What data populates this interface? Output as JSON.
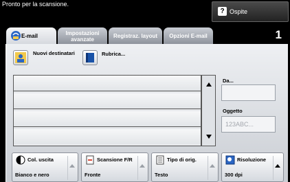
{
  "status_bar": {
    "message": "Pronto per la scansione.",
    "user_label": "Ospite"
  },
  "tabs": [
    {
      "label": "E-mail",
      "active": true
    },
    {
      "label": "Impostazioni avanzate",
      "active": false
    },
    {
      "label": "Registraz. layout",
      "active": false
    },
    {
      "label": "Opzioni E-mail",
      "active": false
    }
  ],
  "page_number": "1",
  "actions": {
    "new_recipients": "Nuovi destinatari",
    "address_book": "Rubrica..."
  },
  "fields": {
    "from_label": "Da...",
    "from_value": "",
    "subject_label": "Oggetto",
    "subject_placeholder": "123ABC..."
  },
  "recipient_rows": [
    "",
    "",
    "",
    ""
  ],
  "bottom_controls": [
    {
      "title": "Col. uscita",
      "value": "Bianco e nero",
      "icon": "half-circle-icon"
    },
    {
      "title": "Scansione F/R",
      "value": "Fronte",
      "icon": "page-icon"
    },
    {
      "title": "Tipo di orig.",
      "value": "Testo",
      "icon": "document-icon"
    },
    {
      "title": "Risoluzione",
      "value": "300 dpi",
      "icon": "resolution-icon"
    }
  ],
  "colors": {
    "accent_blue": "#1a53a8",
    "tab_active": "#eceef1"
  }
}
